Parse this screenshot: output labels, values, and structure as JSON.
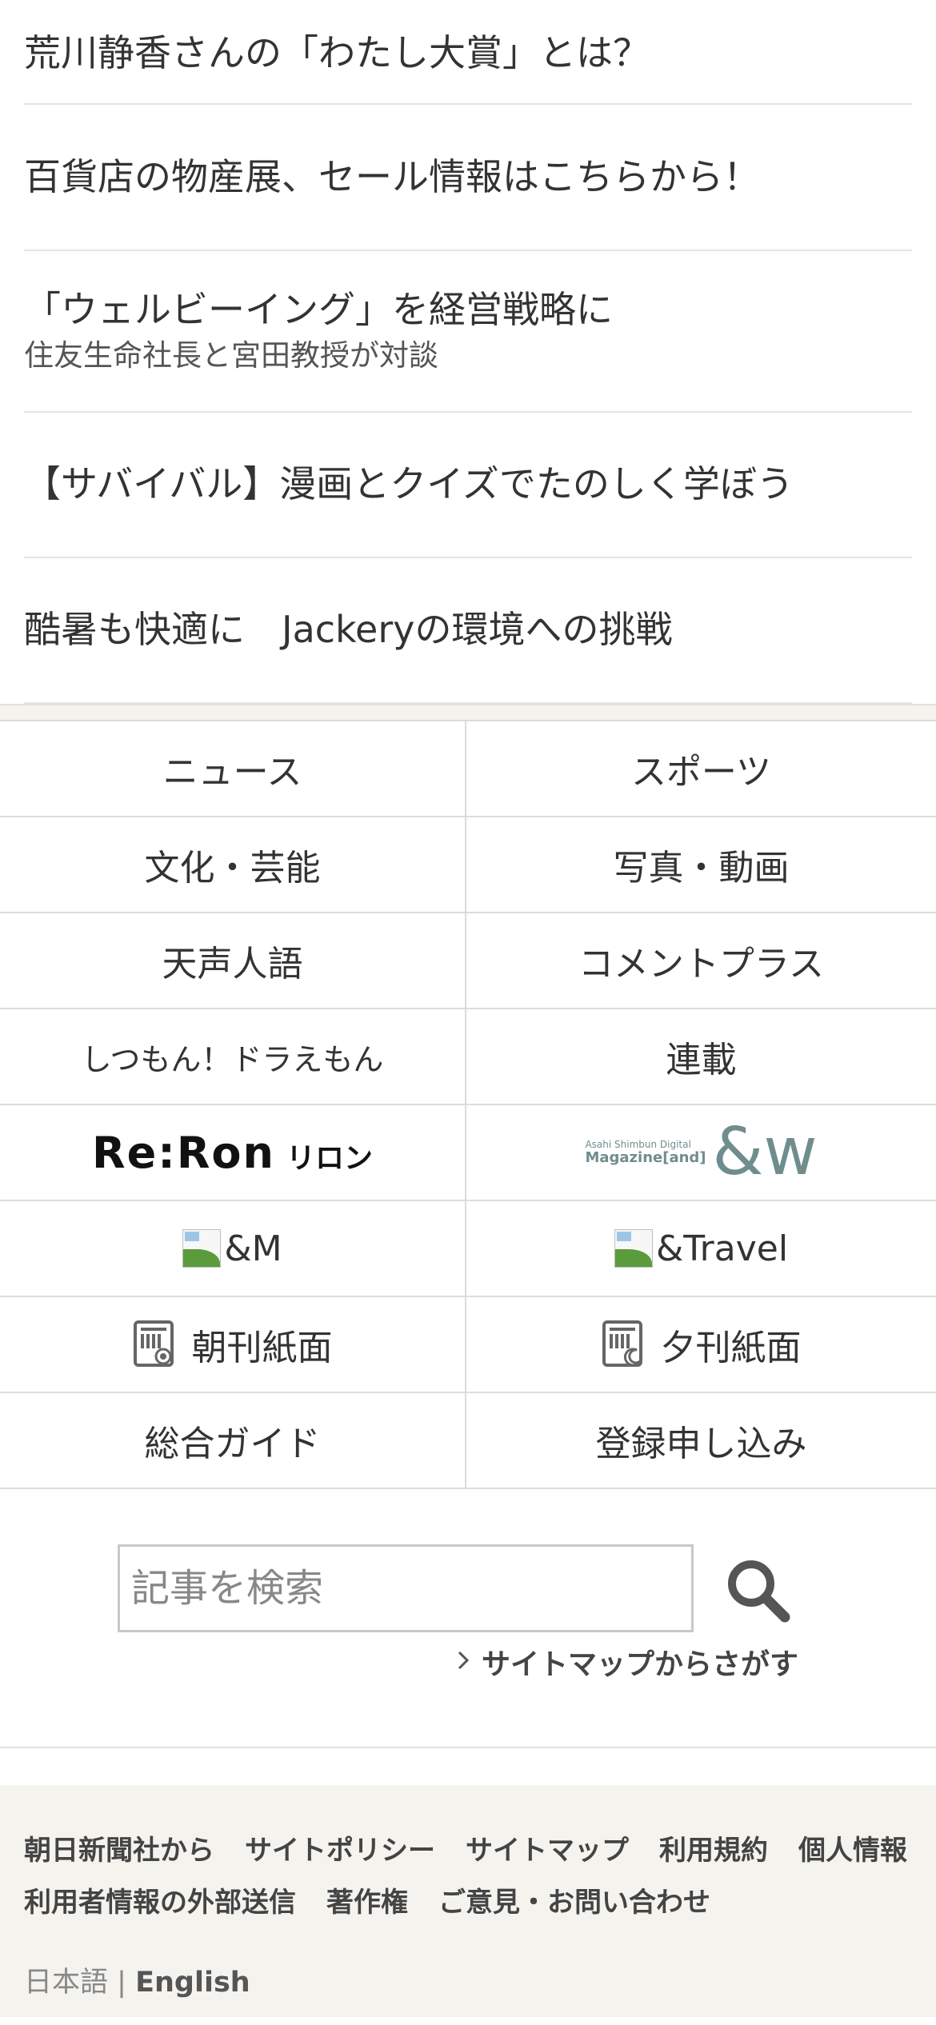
{
  "promos": [
    {
      "title": "荒川静香さんの「わたし大賞」とは？"
    },
    {
      "title": "百貨店の物産展、セール情報はこちらから！"
    },
    {
      "title": "「ウェルビーイング」を経営戦略に",
      "subtitle": "住友生命社長と宮田教授が対談"
    },
    {
      "title": "【サバイバル】漫画とクイズでたのしく学ぼう"
    },
    {
      "title": "酷暑も快適に　Jackeryの環境への挑戦"
    }
  ],
  "nav": {
    "news": "ニュース",
    "sports": "スポーツ",
    "culture": "文化・芸能",
    "photo_video": "写真・動画",
    "tensei": "天声人語",
    "comment_plus": "コメントプラス",
    "doraemon": "しつもん！ドラえもん",
    "series": "連載",
    "reron_logo": "Re:Ron",
    "reron_kana": "リロン",
    "andw_logo_small": "Asahi Shimbun Digital",
    "andw_logo_mag": "Magazine[and]",
    "andw_logo_mark": "&w",
    "and_m": "&M",
    "and_travel": "&Travel",
    "morning": "朝刊紙面",
    "evening": "夕刊紙面",
    "guide": "総合ガイド",
    "register": "登録申し込み"
  },
  "search": {
    "placeholder": "記事を検索",
    "sitemap_link": "サイトマップからさがす"
  },
  "footer": {
    "links": [
      "朝日新聞社から",
      "サイトポリシー",
      "サイトマップ",
      "利用規約",
      "個人情報",
      "利用者情報の外部送信",
      "著作権",
      "ご意見・お問い合わせ"
    ],
    "lang_ja": "日本語",
    "lang_sep": "|",
    "lang_en": "English"
  }
}
